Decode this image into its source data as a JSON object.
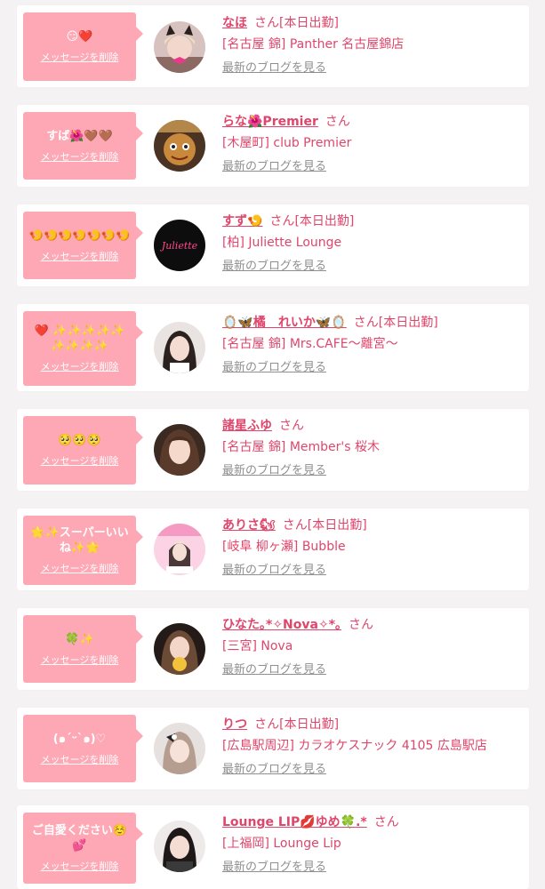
{
  "delete_label": "メッセージを削除",
  "blog_label": "最新のブログを見る",
  "san_label": "さん",
  "colors": {
    "bubble": "#fea7b5",
    "accent": "#e0456b",
    "muted": "#8f8f8f",
    "background": "#f4f2f3"
  },
  "messages": [
    {
      "message": "😏❤️",
      "name": "なほ",
      "status": "[本日出勤]",
      "shop": "[名古屋 錦] Panther 名古屋錦店",
      "avatar_icon": "girl-with-cat-ears-photo"
    },
    {
      "message": "すば🌺🤎🤎",
      "name": "らな🌺Premier",
      "status": "",
      "shop": "[木屋町] club Premier",
      "avatar_icon": "maneki-neko-statue-photo"
    },
    {
      "message": "🍤🍤🍤🍤🍤🍤🍤",
      "name": "すず🍤",
      "status": "[本日出勤]",
      "shop": "[柏] Juliette Lounge",
      "avatar_icon": "juliette-logo"
    },
    {
      "message": "❤️ ✨✨✨✨✨ ✨✨✨✨",
      "name": "🪞🦋橘　れいか🦋🪞",
      "status": "[本日出勤]",
      "shop": "[名古屋 錦] Mrs.CAFE〜離宮〜",
      "avatar_icon": "woman-portrait-photo"
    },
    {
      "message": "🥺🥺🥺",
      "name": "諸星ふゆ",
      "status": "",
      "shop": "[名古屋 錦] Member's 桜木",
      "avatar_icon": "woman-portrait-photo"
    },
    {
      "message": "🌟✨スーパーいいね✨🌟",
      "name": "ありさ🐿",
      "status": "[本日出勤]",
      "shop": "[岐阜 柳ヶ瀬] Bubble",
      "avatar_icon": "bubble-arisa-photo"
    },
    {
      "message": "🍀✨",
      "name": "ひなた｡*✧Nova✧*｡",
      "status": "",
      "shop": "[三宮] Nova",
      "avatar_icon": "woman-with-sticker-photo"
    },
    {
      "message": "(๑´ᵕ`๑)♡",
      "name": "りつ",
      "status": "[本日出勤]",
      "shop": "[広島駅周辺] カラオケスナック 4105 広島駅店",
      "avatar_icon": "woman-with-bow-photo"
    },
    {
      "message": "ご自愛ください☺️💕",
      "name": "Lounge LIP💋ゆめ🍀.*",
      "status": "",
      "shop": "[上福岡] Lounge Lip",
      "avatar_icon": "woman-portrait-photo"
    }
  ]
}
